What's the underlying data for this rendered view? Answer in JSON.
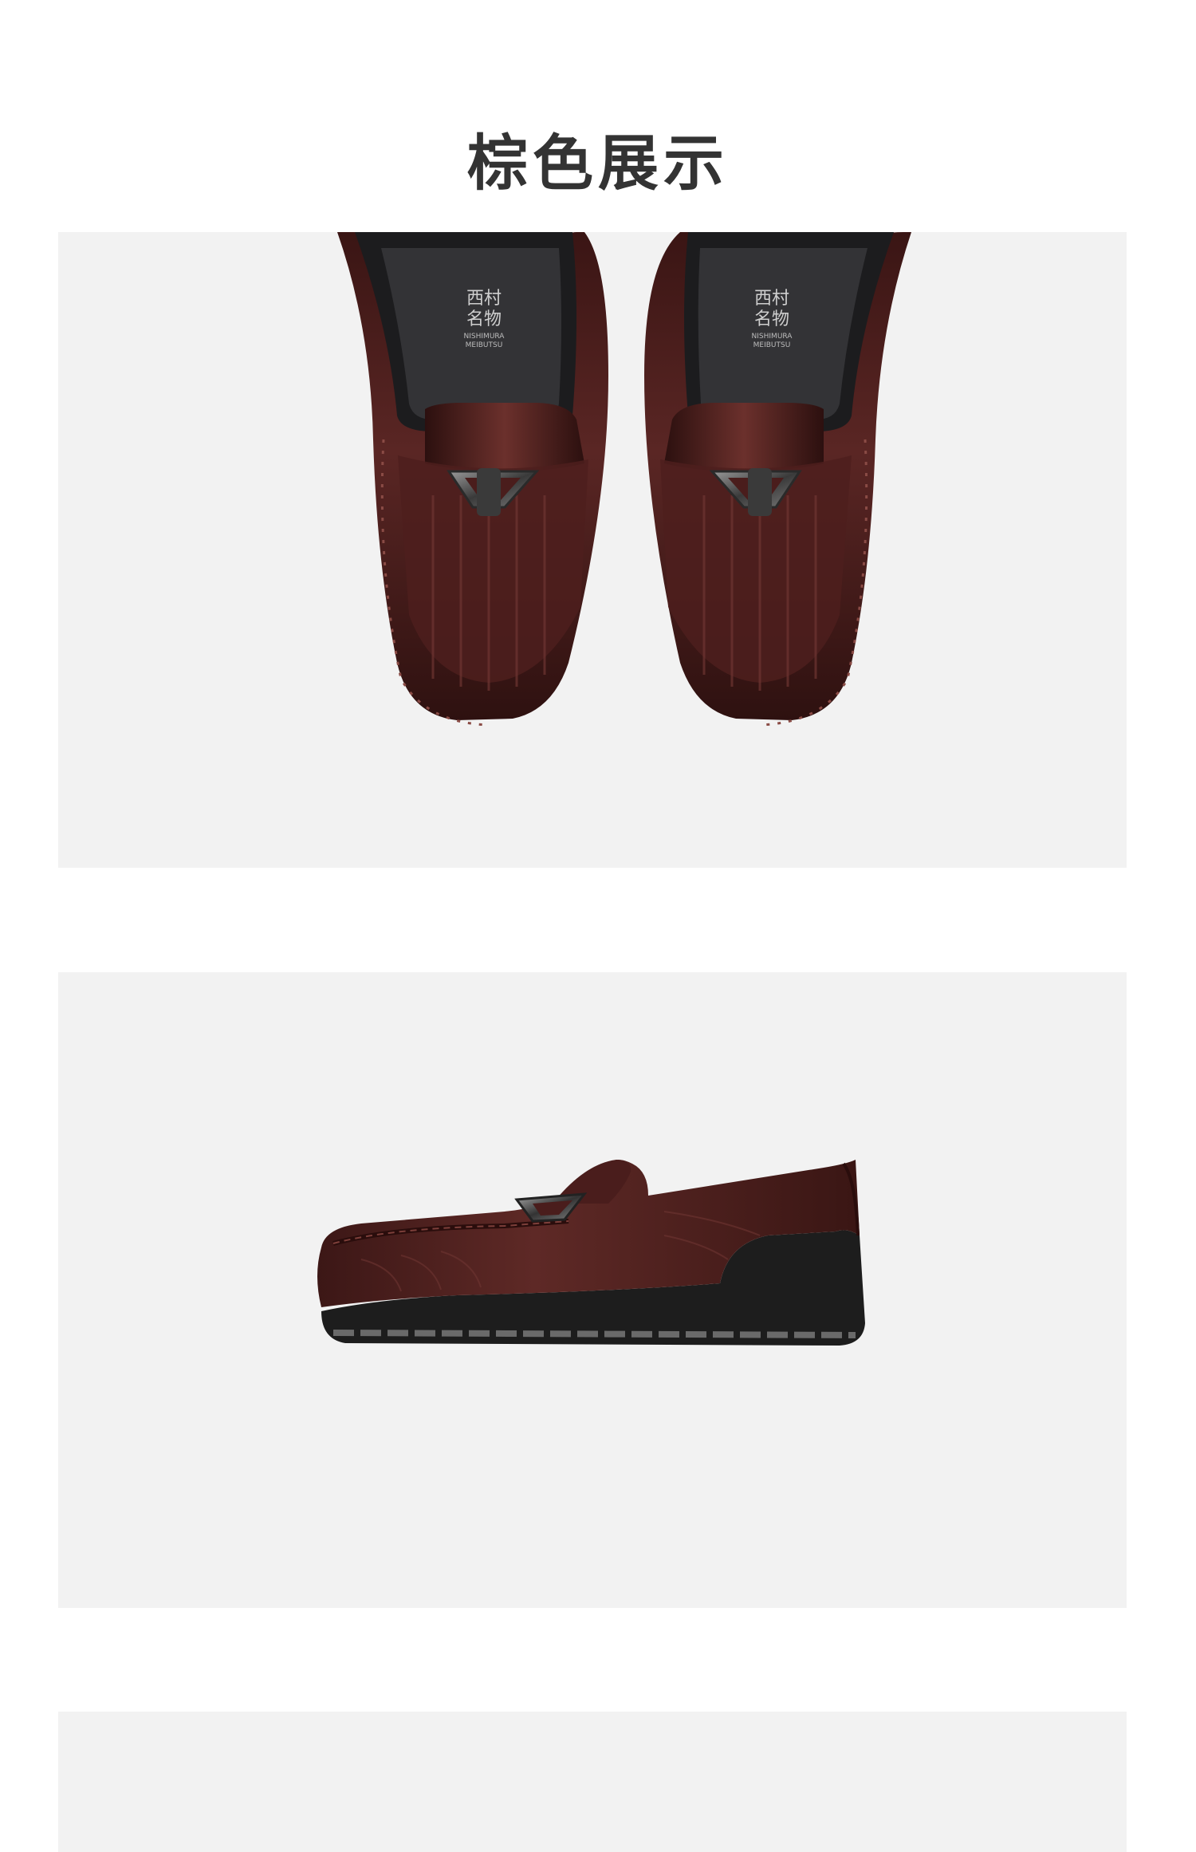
{
  "section": {
    "title": "棕色展示"
  },
  "images": [
    {
      "name": "top-view-loafers",
      "insole_brand_cn_1": "西村",
      "insole_brand_cn_2": "名物",
      "insole_brand_en_1": "NISHIMURA",
      "insole_brand_en_2": "MEIBUTSU"
    },
    {
      "name": "side-view-loafer"
    },
    {
      "name": "next-product-image"
    }
  ],
  "colors": {
    "background": "#ffffff",
    "panel": "#f2f2f2",
    "leather": "#4a1d1c",
    "sole": "#222222",
    "title": "#333333"
  }
}
